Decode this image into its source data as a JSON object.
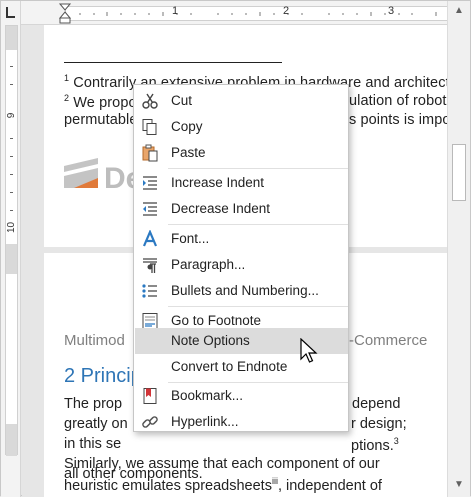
{
  "ruler": {
    "h_numbers": [
      "1",
      "2",
      "3"
    ],
    "v_numbers": [
      "9",
      "10"
    ]
  },
  "page1": {
    "footnote1": {
      "marker": "1",
      "text_before": "Contrarily",
      "text_after": " an extensive problem in hardware and architecture"
    },
    "footnote2_a": {
      "marker": "2",
      "text": "We propo"
    },
    "footnote2_a_right": "ulation of robot",
    "line3_left": "permutable",
    "line3_right": "s points is impo",
    "logo_letters": "De"
  },
  "page2": {
    "header_left": "Multimod",
    "header_right": "-Commerce",
    "heading": "2 Princip",
    "lines": [
      {
        "left": "The prop",
        "right": "depend"
      },
      {
        "left": "greatly on",
        "right": "r design;"
      },
      {
        "left": "in this se",
        "right": "ptions.",
        "sup": "3"
      },
      {
        "left": "Similarly, we assume that each component of our"
      },
      {
        "left": "heuristic emulates spreadsheets",
        "sup": "iii",
        "rest": ", independent of"
      },
      {
        "left": "all other components."
      }
    ]
  },
  "context_menu": {
    "items": [
      {
        "label": "Cut",
        "icon": "scissors-icon"
      },
      {
        "label": "Copy",
        "icon": "copy-icon"
      },
      {
        "label": "Paste",
        "icon": "paste-icon"
      },
      {
        "label": "Increase Indent",
        "icon": "increase-indent-icon"
      },
      {
        "label": "Decrease Indent",
        "icon": "decrease-indent-icon"
      },
      {
        "label": "Font...",
        "icon": "font-icon"
      },
      {
        "label": "Paragraph...",
        "icon": "paragraph-icon"
      },
      {
        "label": "Bullets and Numbering...",
        "icon": "bullets-icon"
      },
      {
        "label": "Go to Footnote",
        "icon": "footnote-icon"
      },
      {
        "label": "Note Options",
        "icon": "",
        "highlighted": true
      },
      {
        "label": "Convert to Endnote",
        "icon": ""
      },
      {
        "label": "Bookmark...",
        "icon": "bookmark-icon"
      },
      {
        "label": "Hyperlink...",
        "icon": "hyperlink-icon"
      }
    ]
  },
  "colors": {
    "heading_blue": "#2e75b6",
    "menu_highlight": "#dcdcdc",
    "icon_blue": "#2b79c2",
    "icon_orange": "#d77c2b",
    "icon_red": "#d13438"
  }
}
